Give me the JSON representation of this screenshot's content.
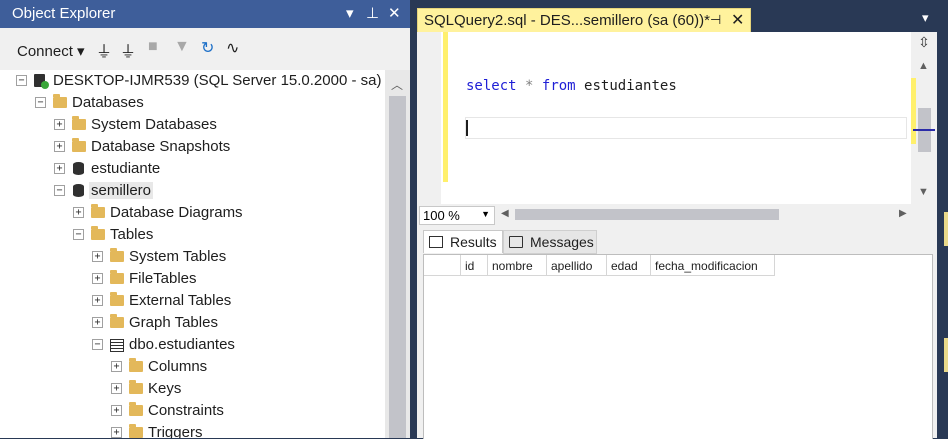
{
  "object_explorer": {
    "title": "Object Explorer",
    "dropdown_icon": "▾",
    "pin_icon": "⊥",
    "close_icon": "✕",
    "toolbar": {
      "connect_label": "Connect ▾",
      "icons": [
        "connect-object-icon",
        "disconnect-icon",
        "stop-icon",
        "filter-icon",
        "refresh-icon",
        "activity-monitor-icon"
      ]
    },
    "tree": {
      "server": "DESKTOP-IJMR539 (SQL Server 15.0.2000 - sa)",
      "databases": "Databases",
      "system_databases": "System Databases",
      "database_snapshots": "Database Snapshots",
      "estudiante": "estudiante",
      "semillero": "semillero",
      "database_diagrams": "Database Diagrams",
      "tables": "Tables",
      "system_tables": "System Tables",
      "file_tables": "FileTables",
      "external_tables": "External Tables",
      "graph_tables": "Graph Tables",
      "dbo_estudiantes": "dbo.estudiantes",
      "columns": "Columns",
      "keys": "Keys",
      "constraints": "Constraints",
      "triggers": "Triggers"
    }
  },
  "query_tab": {
    "title": "SQLQuery2.sql - DES...semillero (sa (60))*",
    "pin": "⊣",
    "close": "✕"
  },
  "editor": {
    "kw_select": "select",
    "op_star": "*",
    "kw_from": "from",
    "table": "estudiantes",
    "zoom": "100 %"
  },
  "results": {
    "tab_results": "Results",
    "tab_messages": "Messages",
    "columns": [
      "id",
      "nombre",
      "apellido",
      "edad",
      "fecha_modificacion"
    ]
  }
}
